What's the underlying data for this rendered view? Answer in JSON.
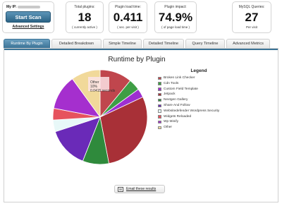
{
  "ip_card": {
    "ip_label": "My IP:",
    "scan_button": "Start Scan",
    "advanced_settings": "Advanced Settings"
  },
  "stats": [
    {
      "title": "Total plugins:",
      "value": "18",
      "sub": "( currently active )"
    },
    {
      "title": "Plugin load time:",
      "value": "0.411",
      "sub": "( sec. per visit )"
    },
    {
      "title": "Plugin impact:",
      "value": "74.9%",
      "sub": "( of page load time )"
    },
    {
      "title": "MySQL Queries:",
      "value": "27",
      "sub": "Per visit"
    }
  ],
  "tabs": [
    {
      "label": "Runtime By Plugin",
      "active": true
    },
    {
      "label": "Detailed Breakdown"
    },
    {
      "label": "Simple Timeline"
    },
    {
      "label": "Detailed Timeline"
    },
    {
      "label": "Query Timeline"
    },
    {
      "label": "Advanced Metrics"
    }
  ],
  "chart": {
    "title": "Runtime by Plugin",
    "legend_title": "Legend",
    "tooltip": [
      "Other",
      "10%",
      "0.0415 seconds"
    ]
  },
  "chart_data": {
    "type": "pie",
    "title": "Runtime by Plugin",
    "slices": [
      {
        "label": "Broken Link Checker",
        "value": 11,
        "color": "#c0464d"
      },
      {
        "label": "Cdn Tools",
        "value": 4,
        "color": "#3e9e45"
      },
      {
        "label": "Custom Field Template",
        "value": 3,
        "color": "#9e2fd0"
      },
      {
        "label": "Jetpack",
        "value": 29,
        "color": "#a83037"
      },
      {
        "label": "Nextgen Gallery",
        "value": 9,
        "color": "#2f8a3c"
      },
      {
        "label": "Share And Follow",
        "value": 14,
        "color": "#6a2ab8"
      },
      {
        "label": "Websitedefender Wordpress Security",
        "value": 4,
        "color": "#e8f8f8"
      },
      {
        "label": "Widgets Reloaded",
        "value": 4,
        "color": "#e6535e"
      },
      {
        "label": "Wp Minify",
        "value": 12,
        "color": "#a52fce"
      },
      {
        "label": "Other",
        "value": 10,
        "color": "#f1d99a"
      }
    ],
    "legend_position": "right"
  },
  "email_button": "Email these results"
}
